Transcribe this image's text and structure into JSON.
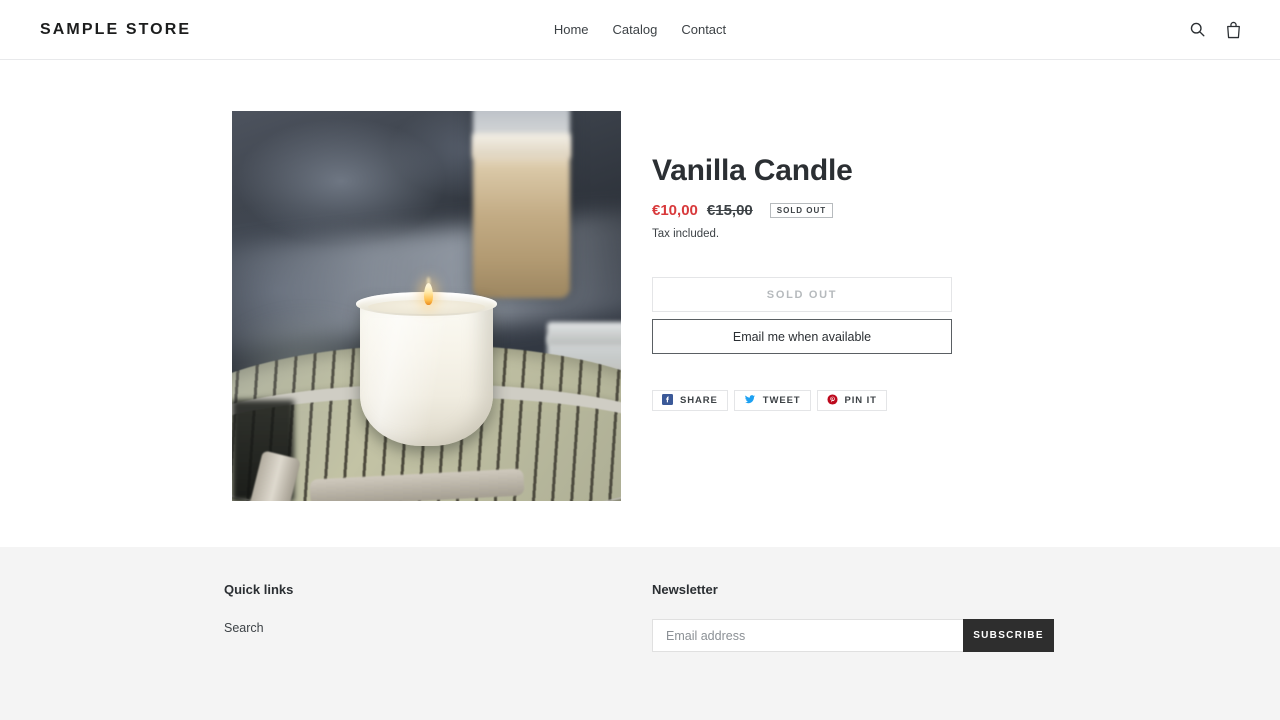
{
  "header": {
    "logo": "SAMPLE STORE",
    "nav": [
      {
        "label": "Home"
      },
      {
        "label": "Catalog"
      },
      {
        "label": "Contact"
      }
    ],
    "icons": {
      "search": "search-icon",
      "cart": "shopping-bag-icon"
    }
  },
  "product": {
    "title": "Vanilla Candle",
    "price_sale": "€10,00",
    "price_compare": "€15,00",
    "availability_badge": "SOLD OUT",
    "tax_note": "Tax included.",
    "sold_out_button": "SOLD OUT",
    "notify_button": "Email me when available",
    "image_alt": "Lit white vanilla candle on a round rattan table with a latte glass and jar behind",
    "share": [
      {
        "label": "SHARE",
        "network": "facebook-icon",
        "color": "#3b5998"
      },
      {
        "label": "TWEET",
        "network": "twitter-icon",
        "color": "#1da1f2"
      },
      {
        "label": "PIN IT",
        "network": "pinterest-icon",
        "color": "#bd081c"
      }
    ]
  },
  "footer": {
    "quick_links": {
      "heading": "Quick links",
      "items": [
        {
          "label": "Search"
        }
      ]
    },
    "newsletter": {
      "heading": "Newsletter",
      "placeholder": "Email address",
      "value": "",
      "submit_label": "SUBSCRIBE"
    }
  },
  "colors": {
    "sale_price": "#d8393b",
    "text": "#3d4246",
    "footer_bg": "#f4f4f4",
    "subscribe_bg": "#2e2e2e"
  }
}
